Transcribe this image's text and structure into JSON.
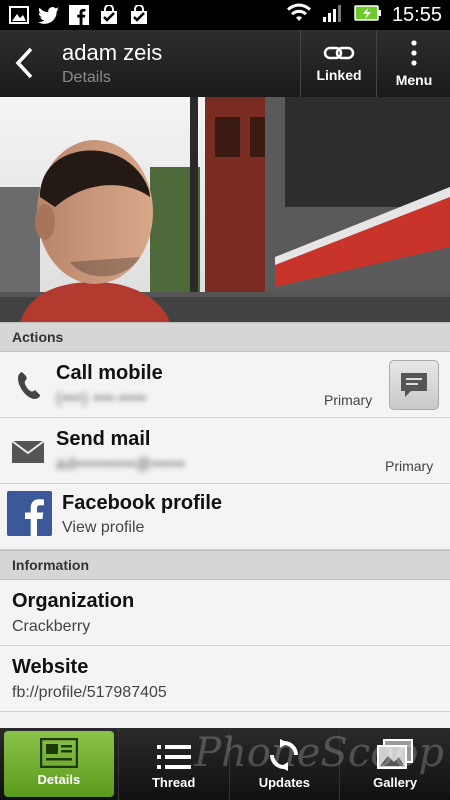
{
  "status_bar": {
    "time": "15:55",
    "left_icons": [
      "gallery-icon",
      "twitter-icon",
      "facebook-icon",
      "shopping-bag-check-icon",
      "shopping-bag-check-icon"
    ],
    "right_icons": [
      "wifi-icon",
      "signal-icon",
      "battery-charging-icon"
    ]
  },
  "header": {
    "title": "adam zeis",
    "subtitle": "Details",
    "linked_label": "Linked",
    "menu_label": "Menu"
  },
  "sections": {
    "actions_title": "Actions",
    "information_title": "Information"
  },
  "actions": {
    "call": {
      "title": "Call mobile",
      "number": "(•••) •••-••••",
      "tag": "Primary"
    },
    "mail": {
      "title": "Send mail",
      "address": "ad•••••••••@•••••",
      "tag": "Primary"
    },
    "facebook": {
      "title": "Facebook profile",
      "sub": "View profile"
    }
  },
  "information": {
    "organization": {
      "label": "Organization",
      "value": "Crackberry"
    },
    "website": {
      "label": "Website",
      "value": "fb://profile/517987405"
    }
  },
  "tabs": [
    {
      "label": "Details",
      "active": true
    },
    {
      "label": "Thread",
      "active": false
    },
    {
      "label": "Updates",
      "active": false
    },
    {
      "label": "Gallery",
      "active": false
    }
  ],
  "watermark": "PhoneScoop",
  "colors": {
    "accent_green": "#6aab24",
    "header_bg": "#242424",
    "content_bg": "#f2f2f2"
  }
}
